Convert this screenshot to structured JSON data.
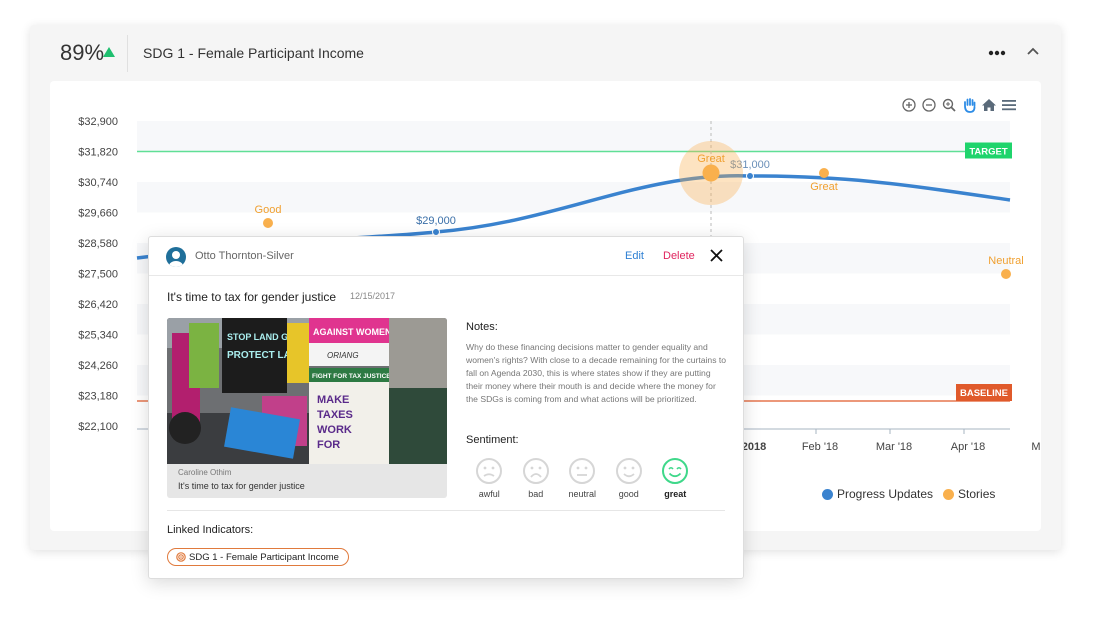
{
  "header": {
    "progress_percent": "89%",
    "trend": "up",
    "title": "SDG 1 - Female Participant Income",
    "more_icon": "more-horizontal-icon",
    "collapse_icon": "chevron-up-icon"
  },
  "toolbar": {
    "icons": [
      "zoom-in-icon",
      "zoom-out-icon",
      "zoom-select-icon",
      "pan-hand-icon",
      "home-reset-icon",
      "menu-icon"
    ]
  },
  "colors": {
    "progress": "#3a83cf",
    "stories": "#f9b04d",
    "target": "#1fd46c",
    "baseline": "#e05a2b",
    "trend_up": "#1fbf6f",
    "great_active": "#3fd88a"
  },
  "chart_data": {
    "type": "line",
    "title": "SDG 1 - Female Participant Income",
    "y_ticks": [
      "$32,900",
      "$31,820",
      "$30,740",
      "$29,660",
      "$28,580",
      "$27,500",
      "$26,420",
      "$25,340",
      "$24,260",
      "$23,180",
      "$22,100"
    ],
    "ylim": [
      22100,
      32900
    ],
    "x_ticks": [
      "2018",
      "Feb '18",
      "Mar '18",
      "Apr '18",
      "M"
    ],
    "target": {
      "label": "TARGET",
      "value": 31820
    },
    "baseline": {
      "label": "BASELINE",
      "value": 23000
    },
    "series": [
      {
        "name": "Progress Updates",
        "points": [
          {
            "x": "Jul '17",
            "y": 28300
          },
          {
            "x": "Oct '17",
            "y": 29000,
            "label": "$29,000"
          },
          {
            "x": "Jan '18",
            "y": 31000,
            "label": "$31,000"
          },
          {
            "x": "Apr '18",
            "y": 30200
          }
        ]
      },
      {
        "name": "Stories",
        "points": [
          {
            "x": "Aug '17",
            "y": 29300,
            "label": "Good"
          },
          {
            "x": "Dec '17",
            "y": 31000,
            "label": "Great",
            "highlighted": true
          },
          {
            "x": "Feb '18",
            "y": 31000,
            "label": "Great"
          },
          {
            "x": "Apr '18",
            "y": 27500,
            "label": "Neutral"
          }
        ]
      }
    ],
    "legend": [
      "Progress Updates",
      "Stories"
    ],
    "legend_position": "bottom-right"
  },
  "modal": {
    "author": "Otto Thornton-Silver",
    "edit_label": "Edit",
    "delete_label": "Delete",
    "title": "It's time to tax for gender justice",
    "date": "12/15/2017",
    "photo_credit": "Caroline Othim",
    "photo_caption": "It's time to tax for gender justice",
    "photo_signs": [
      "STOP LAND GRABS",
      "PROTECT LAND RIGHTS",
      "AGAINST WOMEN!",
      "ORIANG",
      "FIGHT FOR TAX JUSTICE!",
      "MAKE TAXES WORK FOR WOMEN"
    ],
    "notes_label": "Notes:",
    "notes_text": "Why do these financing decisions matter to gender equality and women's rights? With close to a decade remaining for the curtains to fall on Agenda 2030, this is where states show if they are putting their money where their mouth is and decide where the money for the SDGs is coming from and what actions will be prioritized.",
    "sentiment_label": "Sentiment:",
    "sentiments": [
      {
        "label": "awful",
        "selected": false
      },
      {
        "label": "bad",
        "selected": false
      },
      {
        "label": "neutral",
        "selected": false
      },
      {
        "label": "good",
        "selected": false
      },
      {
        "label": "great",
        "selected": true
      }
    ],
    "linked_label": "Linked Indicators:",
    "linked_indicator": "SDG 1 - Female Participant Income"
  }
}
